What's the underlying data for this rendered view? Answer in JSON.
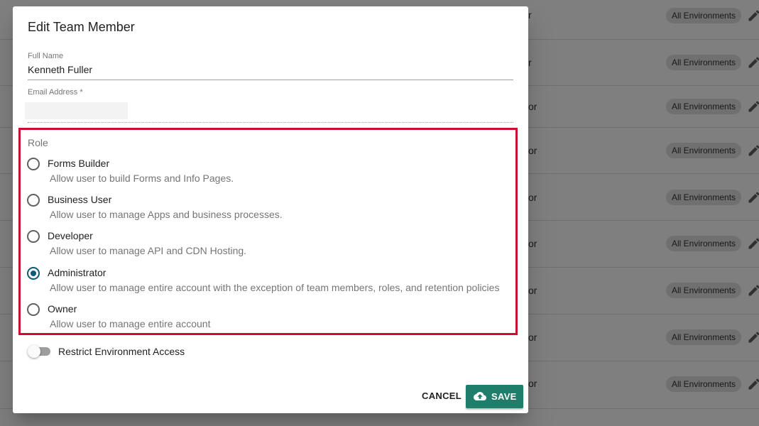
{
  "background": {
    "rows": [
      {
        "role": "r",
        "env": "All Environments"
      },
      {
        "role": "r",
        "env": "All Environments"
      },
      {
        "role": "or",
        "env": "All Environments"
      },
      {
        "role": "or",
        "env": "All Environments"
      },
      {
        "role": "or",
        "env": "All Environments"
      },
      {
        "role": "or",
        "env": "All Environments"
      },
      {
        "role": "or",
        "env": "All Environments"
      },
      {
        "role": "or",
        "env": "All Environments"
      },
      {
        "role": "or",
        "env": "All Environments"
      }
    ]
  },
  "dialog": {
    "title": "Edit Team Member",
    "full_name": {
      "label": "Full Name",
      "value": "Kenneth Fuller"
    },
    "email": {
      "label": "Email Address *",
      "value": ""
    },
    "role": {
      "legend": "Role",
      "options": [
        {
          "name": "Forms Builder",
          "desc": "Allow user to build Forms and Info Pages.",
          "checked": false
        },
        {
          "name": "Business User",
          "desc": "Allow user to manage Apps and business processes.",
          "checked": false
        },
        {
          "name": "Developer",
          "desc": "Allow user to manage API and CDN Hosting.",
          "checked": false
        },
        {
          "name": "Administrator",
          "desc": "Allow user to manage entire account with the exception of team members, roles, and retention policies",
          "checked": true
        },
        {
          "name": "Owner",
          "desc": "Allow user to manage entire account",
          "checked": false
        }
      ]
    },
    "restrict_toggle": {
      "label": "Restrict Environment Access",
      "on": false
    },
    "cancel_label": "CANCEL",
    "save_label": "SAVE"
  },
  "colors": {
    "highlight_border": "#c8102e",
    "save_button": "#1e7d6b",
    "radio_checked": "#0b5a7a"
  },
  "icons": {
    "save": "cloud-upload-icon",
    "edit": "pencil-icon"
  }
}
